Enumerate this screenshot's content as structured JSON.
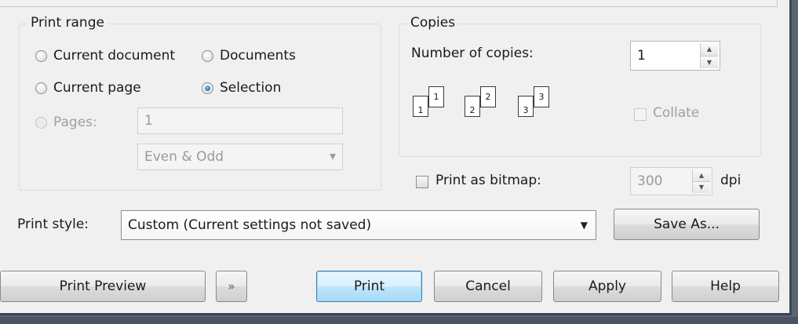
{
  "print_range": {
    "title": "Print range",
    "options": {
      "current_document": "Current document",
      "documents": "Documents",
      "current_page": "Current page",
      "selection": "Selection",
      "pages": "Pages:"
    },
    "selected": "selection",
    "pages_value": "1",
    "page_set": "Even & Odd"
  },
  "copies": {
    "title": "Copies",
    "number_label": "Number of copies:",
    "number_value": "1",
    "collate_label": "Collate",
    "collate_checked": false,
    "page_numbers": [
      "1",
      "1",
      "2",
      "2",
      "3",
      "3"
    ]
  },
  "bitmap": {
    "label": "Print as bitmap:",
    "checked": false,
    "dpi_value": "300",
    "dpi_unit": "dpi"
  },
  "print_style": {
    "label": "Print style:",
    "value": "Custom (Current settings not saved)",
    "save_as": "Save As..."
  },
  "buttons": {
    "print_preview": "Print Preview",
    "expand_icon": "double-chevron-right-icon",
    "print": "Print",
    "cancel": "Cancel",
    "apply": "Apply",
    "help": "Help"
  },
  "colors": {
    "dialog_bg": "#f0f0f0",
    "default_button": "#bee6fd",
    "radio_selected": "#2a6bb0"
  }
}
